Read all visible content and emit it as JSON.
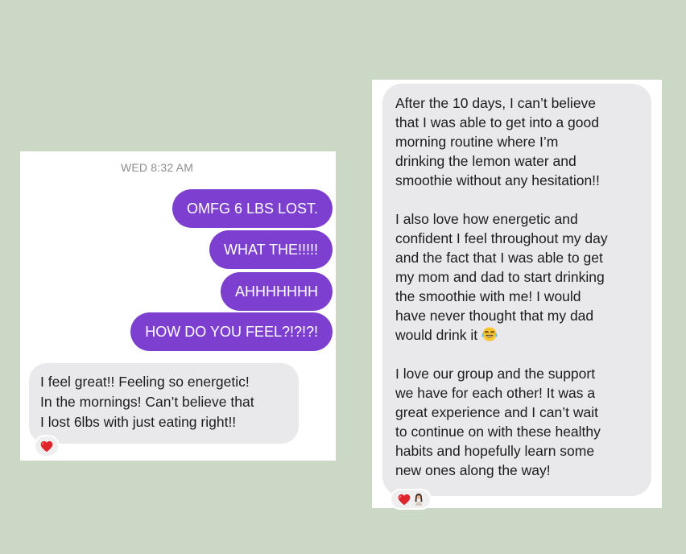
{
  "left_chat": {
    "timestamp": "WED 8:32 AM",
    "outgoing": [
      "OMFG 6 LBS LOST.",
      "WHAT THE!!!!!",
      "AHHHHHHH",
      "HOW DO YOU FEEL?!?!?!"
    ],
    "incoming": {
      "lines": [
        "I feel great!! Feeling so energetic!",
        "In the mornings! Can’t believe that",
        "I lost 6lbs with just eating right!!"
      ],
      "reaction_icon": "red-heart"
    },
    "colors": {
      "outgoing_bubble": "#7c3fcf",
      "incoming_bubble": "#e9e9eb"
    }
  },
  "right_chat": {
    "paragraphs": [
      [
        "After the 10 days, I can’t believe",
        "that I was able to get into a good",
        "morning routine where I’m",
        "drinking the lemon water and",
        "smoothie without any hesitation!!"
      ],
      [
        "I also love how energetic and",
        "confident I feel throughout my day",
        "and the fact that I was able to get",
        "my mom and dad to start drinking",
        "the smoothie with me! I would",
        "have never thought that my dad",
        "would drink it"
      ],
      [
        "I love our group and the support",
        "we have for each other! It was a",
        "great experience and I can’t wait",
        "to continue on with these healthy",
        "habits and hopefully learn some",
        "new ones along the way!"
      ]
    ],
    "inline_emoji": "face-with-tears-of-joy",
    "reaction_icons": [
      "red-heart",
      "woman-avatar"
    ]
  },
  "background_color": "#ccd8c6"
}
